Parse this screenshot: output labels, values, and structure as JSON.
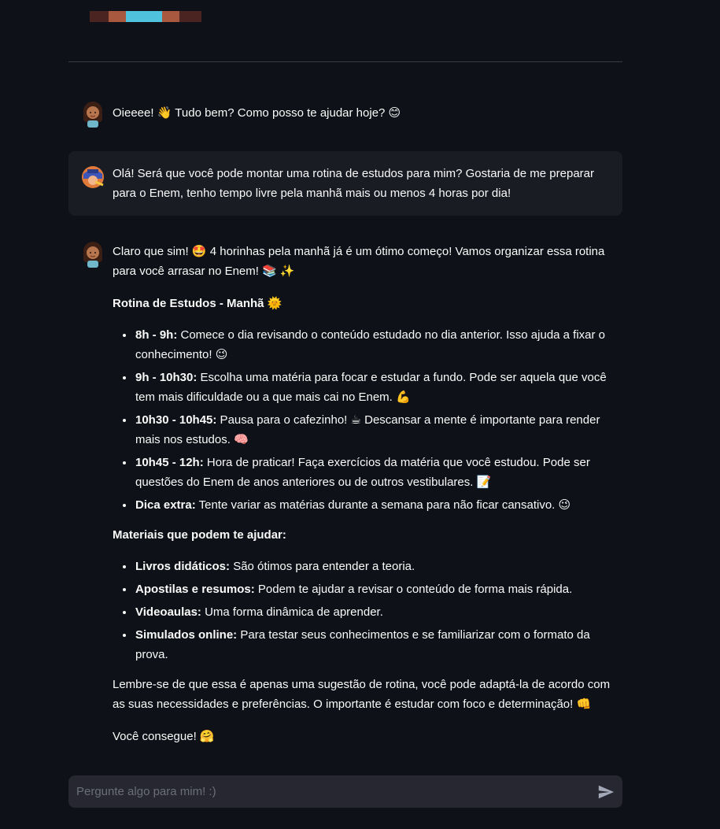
{
  "banner_colors": [
    "#4a2420",
    "#a8583f",
    "#4fc3de",
    "#a8583f",
    "#4a2420"
  ],
  "messages": [
    {
      "role": "assistant",
      "text": "Oieeee! 👋 Tudo bem? Como posso te ajudar hoje? 😊"
    },
    {
      "role": "user",
      "line1": "Olá! Será que você pode montar uma rotina de estudos para mim? Gostaria de me preparar",
      "line2": "para o Enem, tenho tempo livre pela manhã mais ou menos 4 horas por dia!"
    },
    {
      "role": "assistant",
      "intro": "Claro que sim! 🤩 4 horinhas pela manhã já é um ótimo começo! Vamos organizar essa rotina para você arrasar no Enem! 📚 ✨",
      "routine_title": "Rotina de Estudos - Manhã 🌞",
      "routine": [
        {
          "label": "8h - 9h:",
          "text": " Comece o dia revisando o conteúdo estudado no dia anterior. Isso ajuda a fixar o conhecimento! 😉"
        },
        {
          "label": "9h - 10h30:",
          "text": " Escolha uma matéria para focar e estudar a fundo. Pode ser aquela que você tem mais dificuldade ou a que mais cai no Enem. 💪"
        },
        {
          "label": "10h30 - 10h45:",
          "text": " Pausa para o cafezinho! ☕ Descansar a mente é importante para render mais nos estudos. 🧠"
        },
        {
          "label": "10h45 - 12h:",
          "text": " Hora de praticar! Faça exercícios da matéria que você estudou. Pode ser questões do Enem de anos anteriores ou de outros vestibulares. 📝"
        },
        {
          "label": "Dica extra:",
          "text": " Tente variar as matérias durante a semana para não ficar cansativo. 😉"
        }
      ],
      "materials_title": "Materiais que podem te ajudar:",
      "materials": [
        {
          "label": "Livros didáticos:",
          "text": " São ótimos para entender a teoria."
        },
        {
          "label": "Apostilas e resumos:",
          "text": " Podem te ajudar a revisar o conteúdo de forma mais rápida."
        },
        {
          "label": "Videoaulas:",
          "text": " Uma forma dinâmica de aprender."
        },
        {
          "label": "Simulados online:",
          "text": " Para testar seus conhecimentos e se familiarizar com o formato da prova."
        }
      ],
      "closing": "Lembre-se de que essa é apenas uma sugestão de rotina, você pode adaptá-la de acordo com as suas necessidades e preferências. O importante é estudar com foco e determinação! 👊",
      "signoff": "Você consegue! 🤗"
    }
  ],
  "input": {
    "placeholder": "Pergunte algo para mim! :)",
    "value": ""
  },
  "icons": {
    "assistant_avatar": "girl-avatar-icon",
    "user_avatar": "graduate-avatar-icon",
    "send": "send-icon"
  }
}
